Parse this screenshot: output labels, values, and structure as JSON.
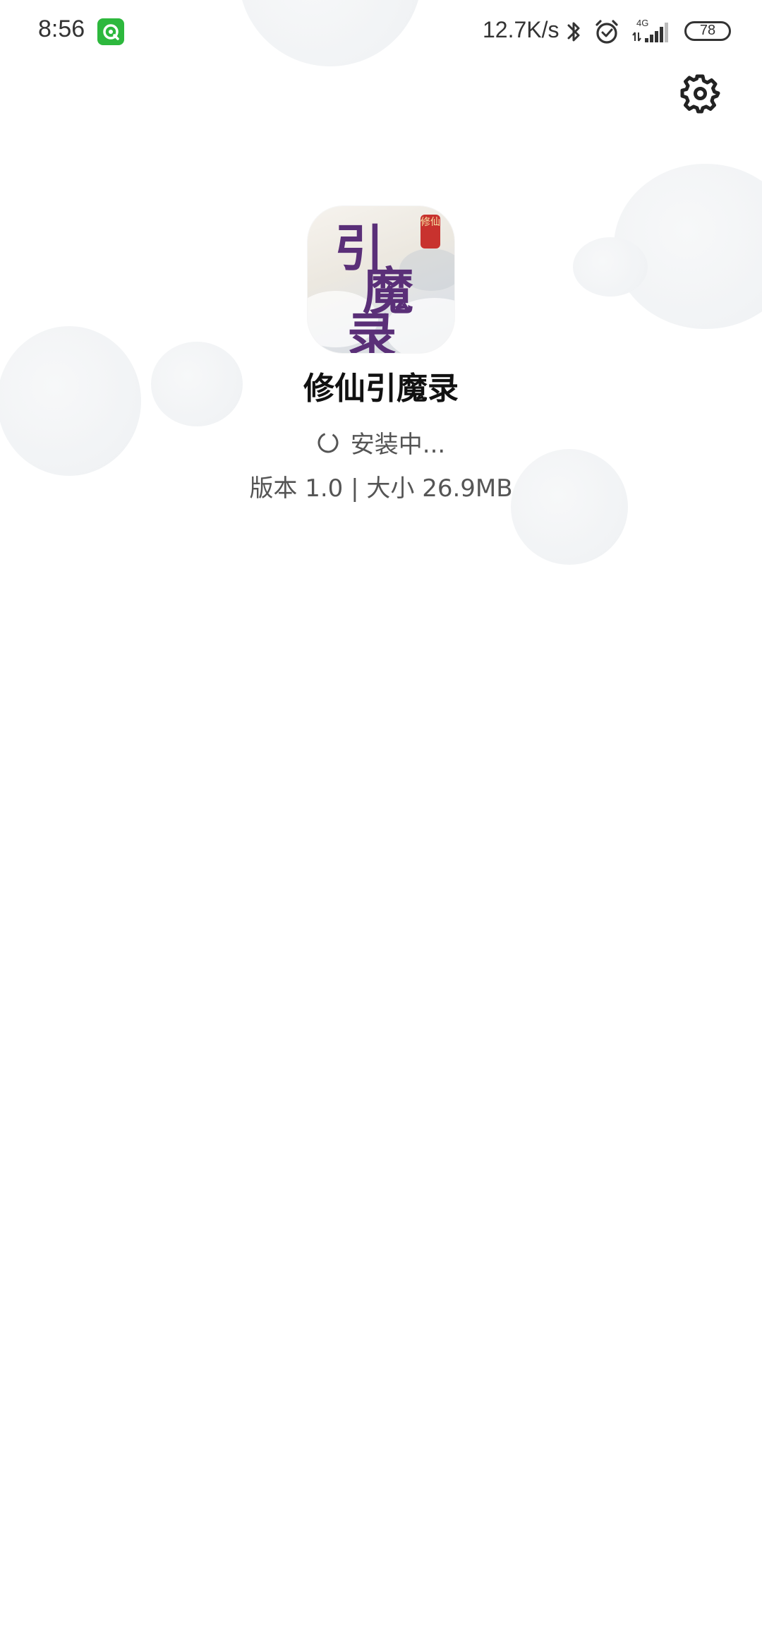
{
  "status_bar": {
    "time": "8:56",
    "network_speed": "12.7K/s",
    "network_type": "4G",
    "battery_percent": "78",
    "notification_icon": "green-app-notification-icon",
    "icons": [
      "bluetooth-icon",
      "alarm-icon",
      "signal-icon",
      "battery-icon"
    ]
  },
  "header": {
    "settings_icon": "gear-icon"
  },
  "app": {
    "name": "修仙引魔录",
    "icon_characters": [
      "引",
      "魔",
      "录"
    ],
    "icon_seal_text": "修仙",
    "install_status": "安装中...",
    "info": "版本 1.0 | 大小 26.9MB"
  },
  "colors": {
    "accent_green": "#2db83d",
    "icon_text_purple": "#5a2f78",
    "seal_red": "#c8322e"
  }
}
